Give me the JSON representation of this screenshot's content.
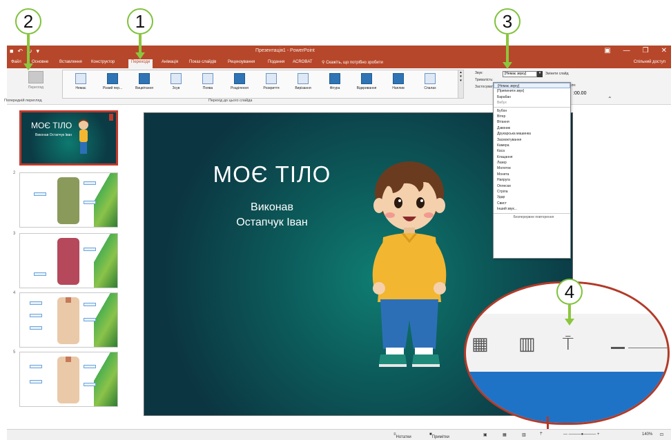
{
  "callouts": [
    "2",
    "1",
    "3",
    "4"
  ],
  "window": {
    "qat_icons": [
      "save-icon",
      "undo-icon",
      "redo-icon",
      "customize-icon"
    ],
    "title": "Презентація1 - PowerPoint",
    "controls": [
      "ribbon-display-icon",
      "minimize-icon",
      "restore-icon",
      "close-icon"
    ]
  },
  "tabs": [
    "Файл",
    "Основне",
    "Вставлення",
    "Конструктор",
    "Переходи",
    "Анімація",
    "Показ слайдів",
    "Рецензування",
    "Подання",
    "ACROBAT"
  ],
  "tabs_active": "Переходи",
  "tell_me": "Скажіть, що потрібно зробити",
  "account": "Спільний доступ",
  "ribbon": {
    "preview_label": "Перегляд",
    "preview_group": "Попередній перегляд",
    "transitions": [
      "Немає",
      "Різкий пер...",
      "Вицвітання",
      "Зсув",
      "Поява",
      "Розділення",
      "Розкриття",
      "Вирізання",
      "Фігура",
      "Відкривання",
      "Наплив",
      "Спалах"
    ],
    "transitions_group": "Перехід до цього слайда",
    "timing": [
      "Звук:",
      "Тривалість:",
      "Застосувати до всіх"
    ],
    "sound_value": "[Немає звуку]",
    "advance_label": "Змінити слайд",
    "after_label": "Після:",
    "spin_value": ":00.00"
  },
  "sound_menu": {
    "items": [
      "[Немає звуку]",
      "[Припинити звук]",
      "Барабан",
      "Вибух",
      "Бубон",
      "Вітер",
      "Вітання",
      "Дзвоник",
      "Друкарська машинка",
      "Засмоктування",
      "Камера",
      "Каса",
      "Клацання",
      "Лазер",
      "Молоток",
      "Монета",
      "Напруга",
      "Оплески",
      "Стріла",
      "Удар",
      "Свист",
      "Інший звук..."
    ],
    "footer": "Безперервне повторення"
  },
  "slides": {
    "numbers": [
      "1",
      "2",
      "3",
      "4",
      "5"
    ],
    "thumb1_title": "МОЄ ТІЛО",
    "thumb1_sub": "Виконав Остапчук Іван"
  },
  "slide": {
    "title": "МОЄ ТІЛО",
    "subtitle_line1": "Виконав",
    "subtitle_line2": "Остапчук Іван"
  },
  "status": {
    "notes": "Нотатки",
    "comments": "Примітки",
    "zoom": "140%"
  },
  "colors": {
    "accent": "#b7472a",
    "callout_green": "#8cc63f",
    "slide_bg": "#0c5a5a"
  }
}
